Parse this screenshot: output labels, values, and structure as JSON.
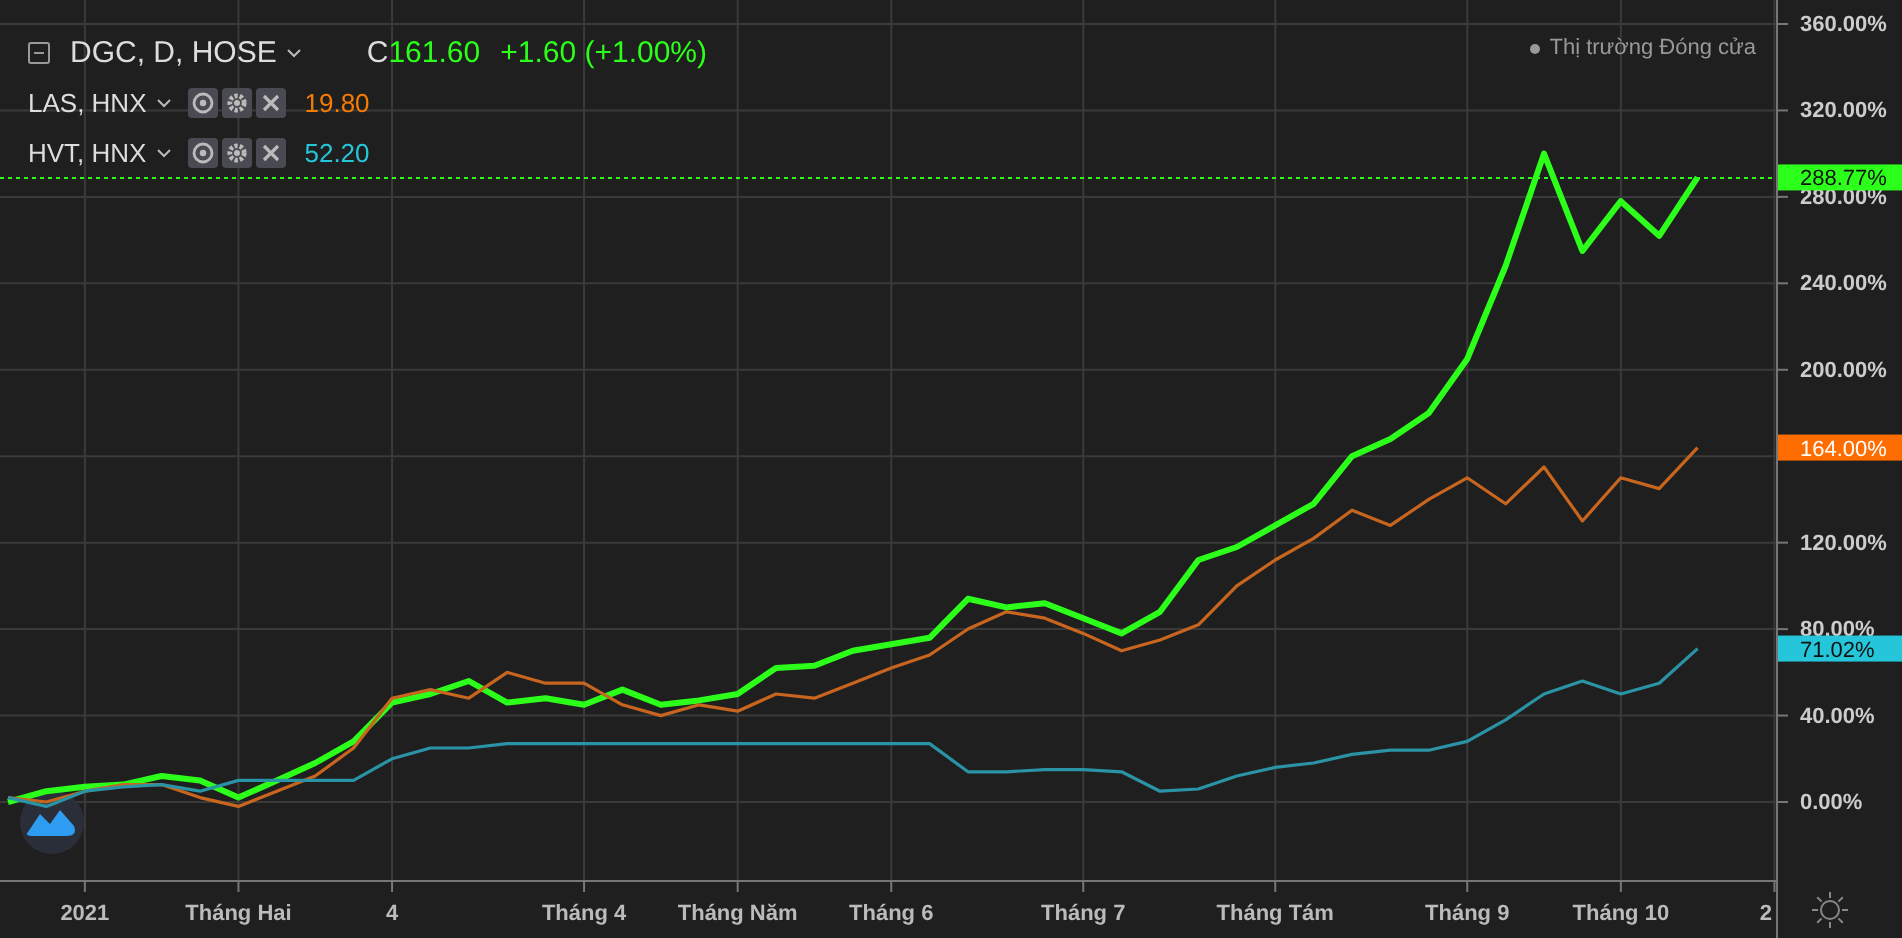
{
  "legend": {
    "main": {
      "close_prefix": "C",
      "close": "161.60",
      "change": "+1.60 (+1.00%)",
      "color": "#2bff1a"
    },
    "compare": [
      {
        "value": "19.80",
        "color": "#f57c00"
      },
      {
        "value": "52.20",
        "color": "#26c6da"
      }
    ]
  },
  "market_status": "Thị trường Đóng cửa",
  "chart_data": {
    "type": "line",
    "grid": true,
    "ref_lines": [
      {
        "axis": "y",
        "value": 288.77
      }
    ],
    "ylim": [
      -36.1,
      371.1
    ],
    "categories": [
      null,
      null,
      "2021",
      null,
      null,
      null,
      "Tháng Hai",
      null,
      null,
      null,
      "4",
      null,
      null,
      null,
      null,
      "Tháng 4",
      null,
      null,
      null,
      "Tháng Năm",
      null,
      null,
      null,
      "Tháng 6",
      null,
      null,
      null,
      null,
      "Tháng 7",
      null,
      null,
      null,
      null,
      "Tháng Tám",
      null,
      null,
      null,
      null,
      "Tháng 9",
      null,
      null,
      null,
      "Tháng 10",
      null,
      null,
      null,
      "2"
    ],
    "yticks": [
      {
        "value": 0,
        "label": "0.00%"
      },
      {
        "value": 40,
        "label": "40.00%"
      },
      {
        "value": 80,
        "label": "80.00%"
      },
      {
        "value": 120,
        "label": "120.00%"
      },
      {
        "value": 200,
        "label": "200.00%"
      },
      {
        "value": 240,
        "label": "240.00%"
      },
      {
        "value": 280,
        "label": "280.00%"
      },
      {
        "value": 320,
        "label": "320.00%"
      },
      {
        "value": 360,
        "label": "360.00%"
      }
    ],
    "series": [
      {
        "name": "DGC, D, HOSE",
        "color": "#2bff1a",
        "values": [
          0,
          5,
          7,
          8,
          12,
          10,
          2,
          10,
          18,
          28,
          46,
          50,
          56,
          46,
          48,
          45,
          52,
          45,
          47,
          50,
          62,
          63,
          70,
          73,
          76,
          94,
          90,
          92,
          85,
          78,
          88,
          112,
          118,
          128,
          138,
          160,
          168,
          180,
          205,
          248,
          300,
          255,
          278,
          262,
          289,
          null,
          null
        ]
      },
      {
        "name": "LAS, HNX",
        "color": "#c8651e",
        "values": [
          2,
          0,
          5,
          8,
          8,
          2,
          -2,
          5,
          12,
          25,
          48,
          52,
          48,
          60,
          55,
          55,
          45,
          40,
          45,
          42,
          50,
          48,
          55,
          62,
          68,
          80,
          88,
          85,
          78,
          70,
          75,
          82,
          100,
          112,
          122,
          135,
          128,
          140,
          150,
          138,
          155,
          130,
          150,
          145,
          164,
          null,
          null
        ]
      },
      {
        "name": "HVT, HNX",
        "color": "#2a93a5",
        "values": [
          2,
          -2,
          5,
          7,
          8,
          5,
          10,
          10,
          10,
          10,
          20,
          25,
          25,
          27,
          27,
          27,
          27,
          27,
          27,
          27,
          27,
          27,
          27,
          27,
          27,
          14,
          14,
          15,
          15,
          14,
          5,
          6,
          12,
          16,
          18,
          22,
          24,
          24,
          28,
          38,
          50,
          56,
          50,
          55,
          71,
          null,
          null
        ]
      }
    ]
  },
  "last_value_tags": [
    {
      "label": "288.77%",
      "color": "#2bff1a"
    },
    {
      "label": "164.00%",
      "color": "#ff6d00"
    },
    {
      "label": "71.02%",
      "color": "#26c6da"
    }
  ]
}
